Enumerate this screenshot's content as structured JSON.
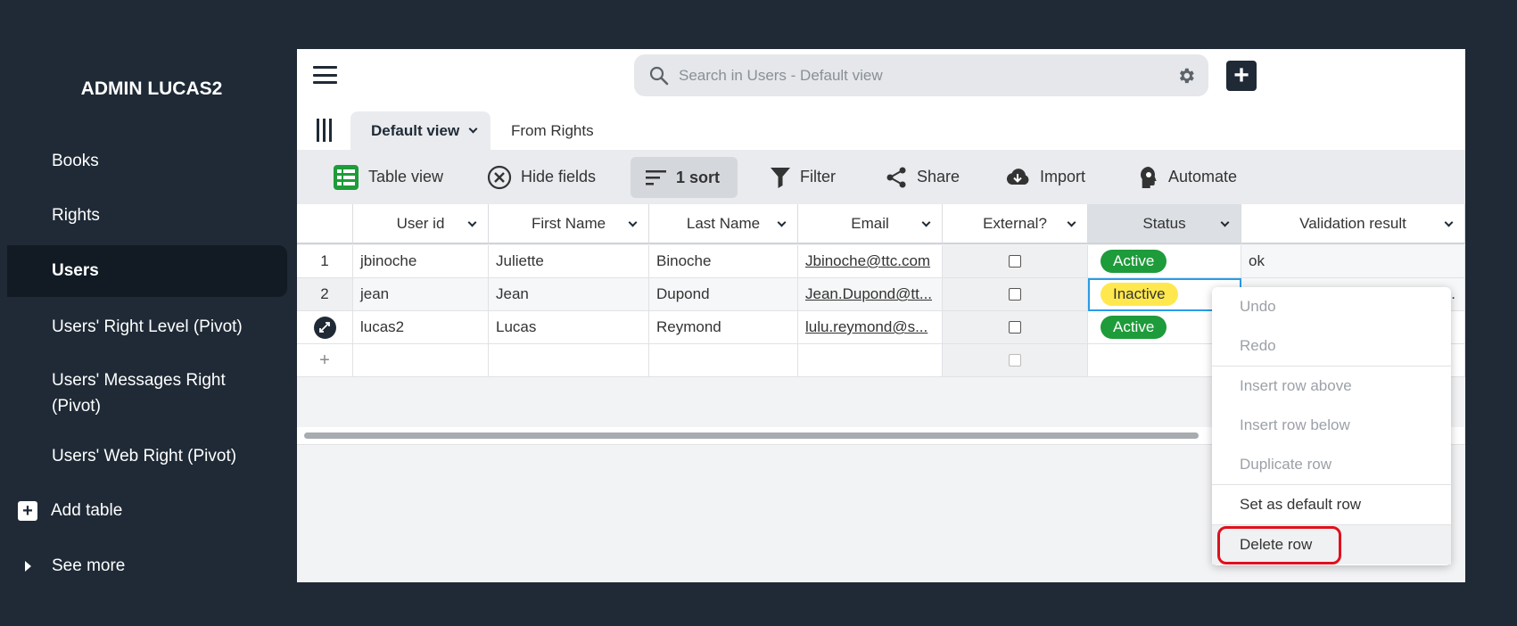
{
  "sidebar": {
    "title": "ADMIN LUCAS2",
    "items": [
      {
        "label": "Books"
      },
      {
        "label": "Rights"
      },
      {
        "label": "Users"
      },
      {
        "label": "Users' Right Level (Pivot)"
      },
      {
        "label": "Users' Messages Right (Pivot)"
      },
      {
        "label": "Users' Web Right (Pivot)"
      }
    ],
    "add_table": "Add table",
    "see_more": "See more"
  },
  "header": {
    "search_placeholder": "Search in Users - Default view"
  },
  "tabs": [
    {
      "label": "Default view"
    },
    {
      "label": "From Rights"
    }
  ],
  "toolbar": {
    "table_view": "Table view",
    "hide_fields": "Hide fields",
    "sort": "1 sort",
    "filter": "Filter",
    "share": "Share",
    "import": "Import",
    "automate": "Automate"
  },
  "table": {
    "columns": [
      "User id",
      "First Name",
      "Last Name",
      "Email",
      "External?",
      "Status",
      "Validation result"
    ],
    "rows": [
      {
        "num": "1",
        "user_id": "jbinoche",
        "first": "Juliette",
        "last": "Binoche",
        "email": "Jbinoche@ttc.com",
        "status": "Active",
        "validation": "ok"
      },
      {
        "num": "2",
        "user_id": "jean",
        "first": "Jean",
        "last": "Dupond",
        "email": "Jean.Dupond@tt...",
        "status": "Inactive",
        "validation": "."
      },
      {
        "num": "",
        "user_id": "lucas2",
        "first": "Lucas",
        "last": "Reymond",
        "email": "lulu.reymond@s...",
        "status": "Active",
        "validation": ""
      }
    ],
    "add_row": "+"
  },
  "context_menu": {
    "items": [
      "Undo",
      "Redo",
      "Insert row above",
      "Insert row below",
      "Duplicate row",
      "Set as default row",
      "Delete row"
    ]
  },
  "colors": {
    "sidebar_bg": "#1f2a36",
    "active_badge": "#1e9b3a",
    "inactive_badge": "#ffe84d",
    "highlight_ring": "#e0101c",
    "selection": "#2a9be8"
  }
}
